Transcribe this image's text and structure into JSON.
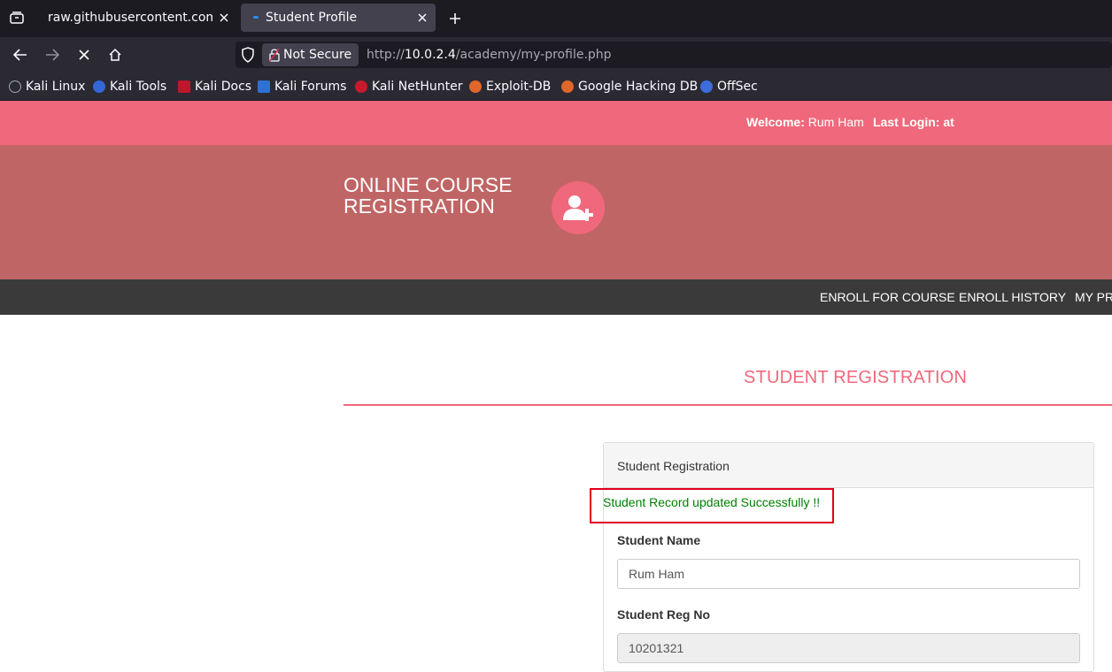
{
  "browser": {
    "tabs": [
      {
        "title": "raw.githubusercontent.com/p",
        "active": false
      },
      {
        "title": "Student Profile",
        "active": true
      }
    ],
    "security_label": "Not Secure",
    "url_prefix": "http://",
    "url_host": "10.0.2.4",
    "url_path": "/academy/my-profile.php",
    "bookmarks": [
      {
        "label": "Kali Linux",
        "icon": "kali-dragon-icon"
      },
      {
        "label": "Kali Tools",
        "icon": "kali-tools-icon"
      },
      {
        "label": "Kali Docs",
        "icon": "kali-docs-icon"
      },
      {
        "label": "Kali Forums",
        "icon": "kali-forums-icon"
      },
      {
        "label": "Kali NetHunter",
        "icon": "kali-nethunter-icon"
      },
      {
        "label": "Exploit-DB",
        "icon": "exploit-db-icon"
      },
      {
        "label": "Google Hacking DB",
        "icon": "ghdb-icon"
      },
      {
        "label": "OffSec",
        "icon": "offsec-icon"
      }
    ]
  },
  "topbar": {
    "welcome_label": "Welcome:",
    "user_name": "Rum Ham",
    "last_login_label": "Last Login: at"
  },
  "header": {
    "brand_line1": "ONLINE COURSE",
    "brand_line2": "REGISTRATION"
  },
  "menu": [
    "ENROLL FOR COURSE",
    "ENROLL HISTORY",
    "MY PR"
  ],
  "main": {
    "section_title": "STUDENT REGISTRATION",
    "panel_title": "Student Registration",
    "success_message": "Student Record updated Successfully !!",
    "fields": [
      {
        "label": "Student Name",
        "value": "Rum Ham",
        "readonly": false
      },
      {
        "label": "Student Reg No",
        "value": "10201321",
        "readonly": true
      }
    ]
  },
  "colors": {
    "accent": "#f0687b",
    "header_bg": "#c06565",
    "menubar_bg": "#3a3a3a",
    "success": "#008000",
    "highlight": "#e0001a"
  }
}
